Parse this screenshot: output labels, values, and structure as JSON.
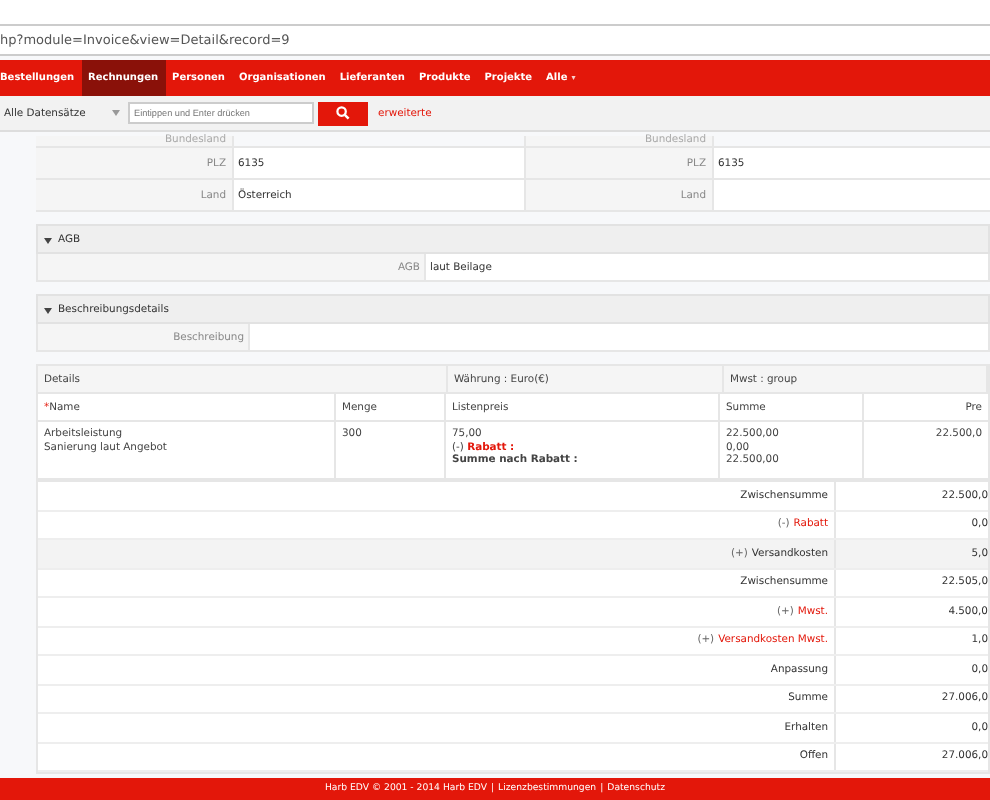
{
  "address_bar": {
    "url": "hp?module=Invoice&view=Detail&record=9"
  },
  "nav": [
    {
      "label": "Bestellungen",
      "selected": false
    },
    {
      "label": "Rechnungen",
      "selected": true
    },
    {
      "label": "Personen",
      "selected": false
    },
    {
      "label": "Organisationen",
      "selected": false
    },
    {
      "label": "Lieferanten",
      "selected": false
    },
    {
      "label": "Produkte",
      "selected": false
    },
    {
      "label": "Projekte",
      "selected": false
    },
    {
      "label": "Alle",
      "selected": false,
      "caret": "▾"
    }
  ],
  "search": {
    "filter": "Alle Datensätze",
    "placeholder": "Eintippen und Enter drücken",
    "advanced": "erweiterte"
  },
  "address_rows": [
    {
      "label": "Bundesland",
      "label2": "Bundesland"
    },
    {
      "label": "PLZ",
      "value": "6135",
      "label2": "PLZ",
      "value2": "6135"
    },
    {
      "label": "Land",
      "value": "Österreich",
      "label2": "Land"
    }
  ],
  "sections": [
    {
      "title": "AGB",
      "expanded": true,
      "label": "AGB",
      "value": "laut Beilage"
    },
    {
      "title": "Beschreibungsdetails",
      "expanded": true,
      "label": "Beschreibung"
    }
  ],
  "items_table": {
    "group_headers": [
      "Details",
      "Währung : Euro(€)",
      "Mwst : group"
    ],
    "columns": [
      {
        "label": "Name",
        "marker": "*"
      },
      {
        "label": "Menge"
      },
      {
        "label": "Listenpreis"
      },
      {
        "label": "Summe"
      },
      {
        "label": "Pre"
      }
    ],
    "rows": [
      {
        "name": [
          "Arbeitsleistung",
          "Sanierung laut Angebot"
        ],
        "menge": "300",
        "listenpreis": "75,00",
        "rabatt_sign": "(-)",
        "rabatt_label": "Rabatt :",
        "nach_rabatt": "Summe nach Rabatt :",
        "summe": [
          "22.500,00",
          "0,00",
          "22.500,00"
        ],
        "preis": "22.500,0"
      }
    ]
  },
  "totals": [
    {
      "label": "Zwischensumme",
      "highlight": false,
      "shaded": false,
      "value": "22.500,0"
    },
    {
      "sign": "(-)",
      "label": "Rabatt",
      "highlight": true,
      "shaded": false,
      "value": "0,0"
    },
    {
      "sign": "(+)",
      "label": "Versandkosten",
      "highlight": false,
      "shaded": true,
      "value": "5,0"
    },
    {
      "label": "Zwischensumme",
      "highlight": false,
      "shaded": false,
      "value": "22.505,0"
    },
    {
      "sign": "(+)",
      "label": "Mwst.",
      "highlight": true,
      "shaded": false,
      "value": "4.500,0"
    },
    {
      "sign": "(+)",
      "label": "Versandkosten Mwst.",
      "highlight": true,
      "shaded": false,
      "value": "1,0"
    },
    {
      "label": "Anpassung",
      "highlight": false,
      "shaded": false,
      "value": "0,0"
    },
    {
      "label": "Summe",
      "highlight": false,
      "shaded": false,
      "value": "27.006,0"
    },
    {
      "label": "Erhalten",
      "highlight": false,
      "shaded": false,
      "value": "0,0"
    },
    {
      "label": "Offen",
      "highlight": false,
      "shaded": false,
      "value": "27.006,0"
    }
  ],
  "footer": {
    "text": "Harb EDV © 2001 - 2014  Harb EDV",
    "links": [
      {
        "separator": "|",
        "label": "Lizenzbestimmungen"
      },
      {
        "separator": "|",
        "label": "Datenschutz"
      }
    ]
  }
}
